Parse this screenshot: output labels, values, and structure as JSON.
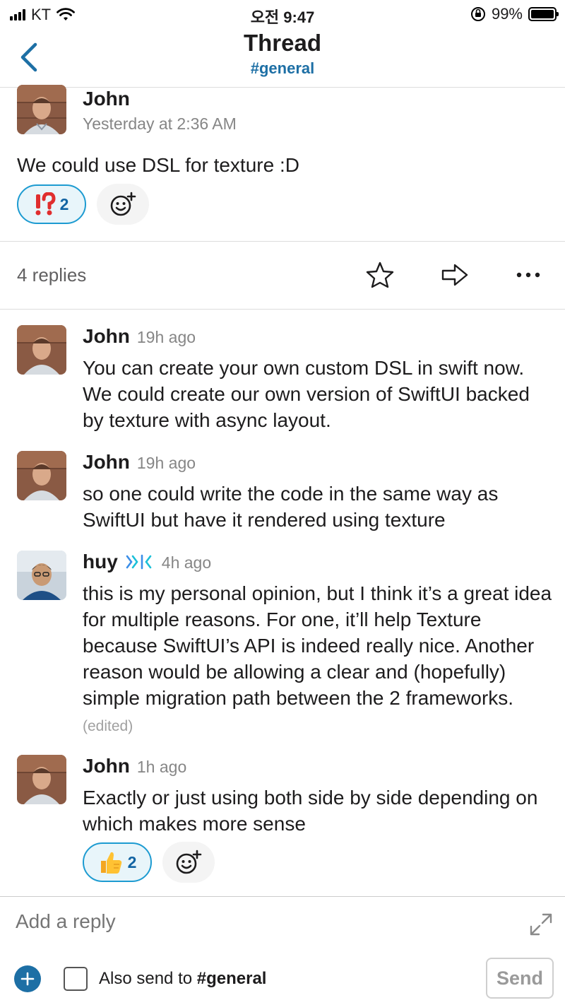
{
  "status_bar": {
    "carrier": "KT",
    "time": "오전 9:47",
    "battery": "99%"
  },
  "nav": {
    "title": "Thread",
    "channel": "#general"
  },
  "parent_message": {
    "author": "John",
    "timestamp": "Yesterday at 2:36 AM",
    "text": "We could use DSL for texture :D",
    "reaction": {
      "emoji": "⁉️",
      "count": "2"
    }
  },
  "thread_bar": {
    "replies_label": "4 replies"
  },
  "replies": [
    {
      "author": "John",
      "time": "19h ago",
      "text": "You can create your own custom DSL in swift now. We could create our own version of SwiftUI backed by texture with async layout."
    },
    {
      "author": "John",
      "time": "19h ago",
      "text": "so one could write the code in the same way as SwiftUI but have it rendered using texture"
    },
    {
      "author": "huy",
      "time": "4h ago",
      "text": "this is my personal opinion, but I think it’s a great idea for multiple reasons. For one, it’ll help Texture because SwiftUI’s API is indeed really nice. Another reason would be allowing a clear and (hopefully) simple migration path between the 2 frameworks.",
      "edited": "(edited)"
    },
    {
      "author": "John",
      "time": "1h ago",
      "text": "Exactly or just using both side by side depending on which makes more sense",
      "reaction": {
        "emoji": "👍",
        "count": "2"
      }
    }
  ],
  "composer": {
    "placeholder": "Add a reply",
    "also_send_prefix": "Also send to ",
    "also_send_channel": "#general",
    "send_label": "Send"
  },
  "colors": {
    "accent": "#1d6fa5",
    "reaction_border": "#1d9bd1",
    "reaction_bg": "#e8f5fa"
  }
}
